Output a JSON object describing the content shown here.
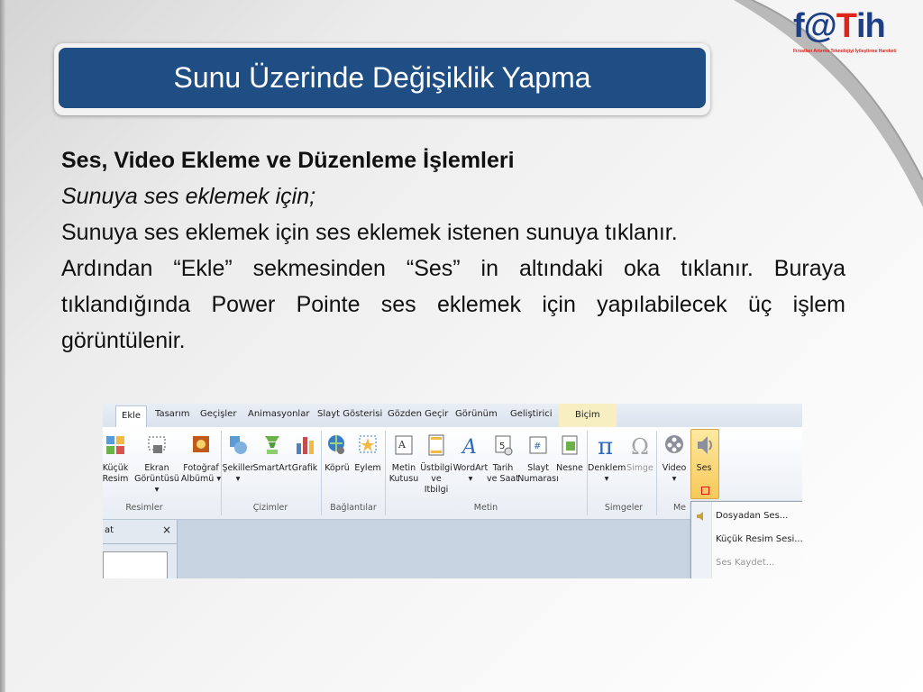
{
  "slide": {
    "title": "Sunu Üzerinde Değişiklik Yapma",
    "heading": "Ses, Video Ekleme ve Düzenleme İşlemleri",
    "subheading": "Sunuya ses eklemek için;",
    "line1": "Sunuya ses eklemek için ses eklemek istenen sunuya tıklanır.",
    "paragraph": "Ardından “Ekle” sekmesinden “Ses” in altındaki oka tıklanır. Buraya tıklandığında Power Pointe ses eklemek için yapılabilecek üç işlem görüntülenir."
  },
  "logo": {
    "f": "f",
    "at": "@",
    "t": "T",
    "ih": "ih",
    "subtitle": "Fırsatları Artırma Teknolojiyi İyileştirme Hareketi"
  },
  "ribbon": {
    "tabs": [
      "Ekle",
      "Tasarım",
      "Geçişler",
      "Animasyonlar",
      "Slayt Gösterisi",
      "Gözden Geçir",
      "Görünüm",
      "Geliştirici",
      "Biçim"
    ],
    "buttons": [
      {
        "l1": "Küçük",
        "l2": "Resim"
      },
      {
        "l1": "Ekran",
        "l2": "Görüntüsü ▾"
      },
      {
        "l1": "Fotoğraf",
        "l2": "Albümü ▾"
      },
      {
        "l1": "Şekiller",
        "l2": "▾"
      },
      {
        "l1": "SmartArt",
        "l2": ""
      },
      {
        "l1": "Grafik",
        "l2": ""
      },
      {
        "l1": "Köprü",
        "l2": ""
      },
      {
        "l1": "Eylem",
        "l2": ""
      },
      {
        "l1": "Metin",
        "l2": "Kutusu"
      },
      {
        "l1": "Üstbilgi",
        "l2": "ve Itbilgi"
      },
      {
        "l1": "WordArt",
        "l2": "▾"
      },
      {
        "l1": "Tarih",
        "l2": "ve Saat"
      },
      {
        "l1": "Slayt",
        "l2": "Numarası"
      },
      {
        "l1": "Nesne",
        "l2": ""
      },
      {
        "l1": "Denklem",
        "l2": "▾"
      },
      {
        "l1": "Simge",
        "l2": ""
      },
      {
        "l1": "Video",
        "l2": "▾"
      },
      {
        "l1": "Ses",
        "l2": ""
      }
    ],
    "groups": [
      "Resimler",
      "Çizimler",
      "Bağlantılar",
      "Metin",
      "Simgeler",
      "Me"
    ],
    "pane_label": "at",
    "pane_close": "×",
    "menu": [
      "Dosyadan Ses...",
      "Küçük Resim Sesi...",
      "Ses Kaydet..."
    ]
  },
  "colors": {
    "banner": "#1f4e85",
    "logo_blue": "#1d3f86",
    "logo_red": "#e0231b",
    "ses_highlight": "#f7c95a"
  }
}
